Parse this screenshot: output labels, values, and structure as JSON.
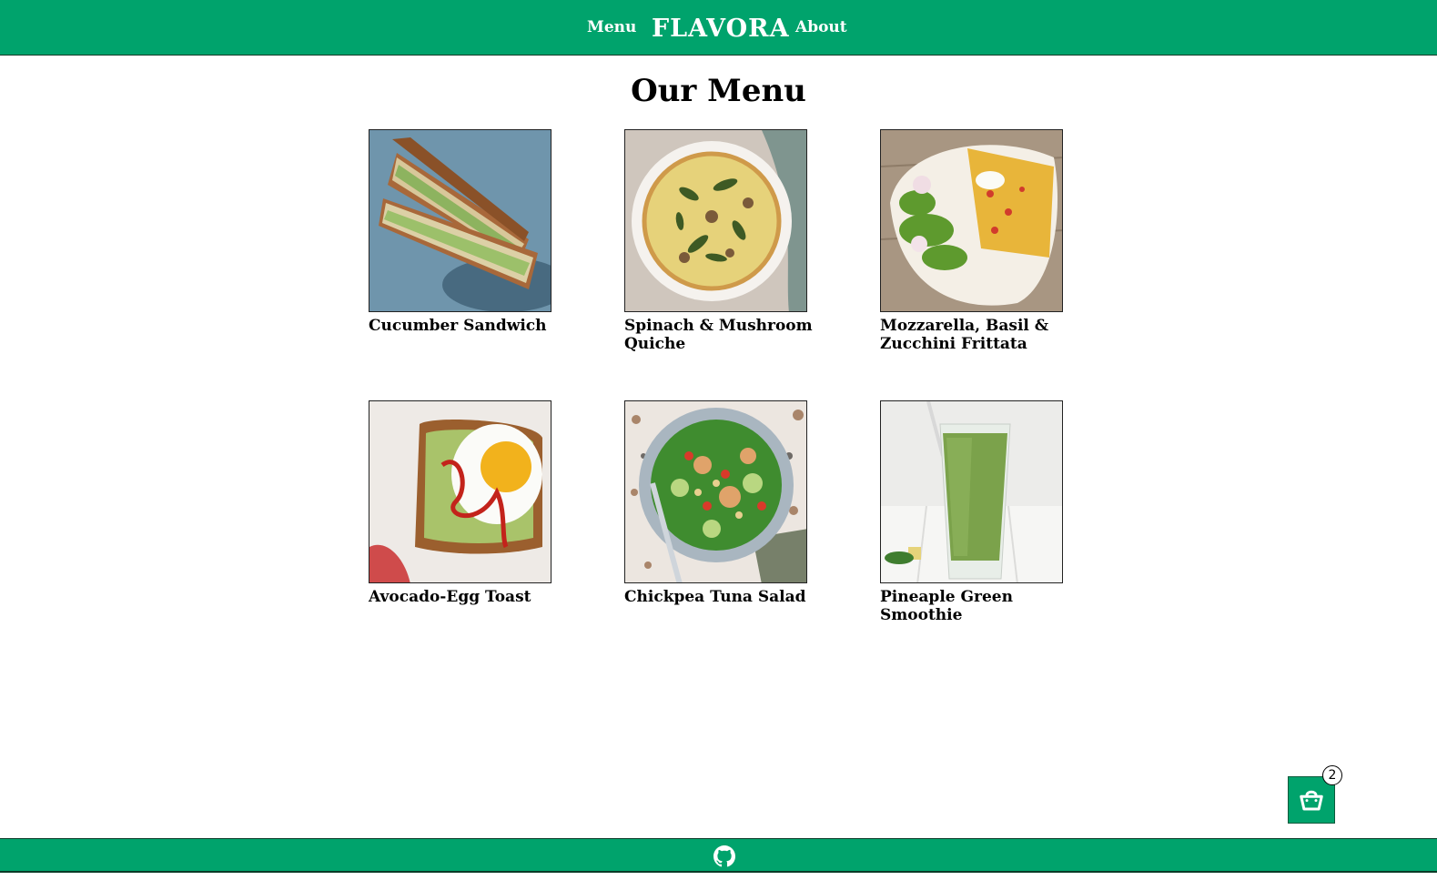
{
  "header": {
    "nav_menu": "Menu",
    "brand": "FLAVORA",
    "nav_about": "About"
  },
  "main": {
    "title": "Our Menu",
    "items": [
      {
        "name": "Cucumber Sandwich",
        "image": "cucumber-sandwich-image"
      },
      {
        "name": "Spinach & Mushroom Quiche",
        "image": "quiche-image"
      },
      {
        "name": "Mozzarella, Basil & Zucchini Frittata",
        "image": "frittata-image"
      },
      {
        "name": "Avocado-Egg Toast",
        "image": "avocado-toast-image"
      },
      {
        "name": "Chickpea Tuna Salad",
        "image": "tuna-salad-image"
      },
      {
        "name": "Pineaple Green Smoothie",
        "image": "green-smoothie-image"
      }
    ]
  },
  "cart": {
    "count": "2",
    "icon": "shopping-bag-icon"
  },
  "footer": {
    "icon": "github-icon"
  },
  "colors": {
    "brand_green": "#00a36c",
    "text": "#000000",
    "background": "#ffffff"
  }
}
